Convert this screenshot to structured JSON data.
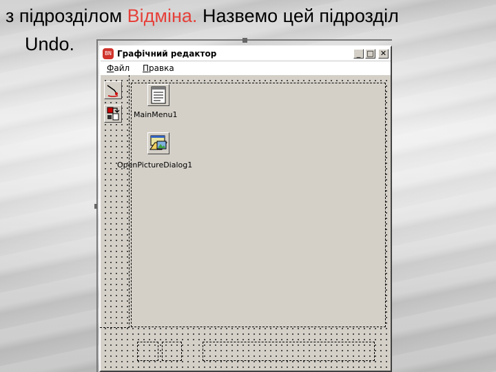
{
  "slide": {
    "line1_start": "з підрозділом ",
    "line1_highlight": "Відміна.",
    "line1_end": " Назвемо цей підрозділ",
    "line2": "Undo."
  },
  "window": {
    "title": "Графічний редактор",
    "icon_text": "BN",
    "buttons": {
      "minimize": "_",
      "maximize": "□",
      "close": "✕"
    }
  },
  "menu": {
    "items": [
      {
        "label_u": "Ф",
        "label_rest": "айл"
      },
      {
        "label_u": "П",
        "label_rest": "равка"
      }
    ]
  },
  "components": {
    "main_menu": {
      "label": "MainMenu1",
      "icon": "main-menu-component-icon"
    },
    "open_picture_dialog": {
      "label": "OpenPictureDialog1",
      "icon": "open-picture-dialog-icon"
    }
  },
  "toolbar": {
    "tools": [
      {
        "icon": "pen-tool-icon"
      },
      {
        "icon": "fill-tool-icon"
      }
    ]
  },
  "colors": {
    "highlight": "#e5403a",
    "form_bg": "#d4d0c8",
    "app_icon": "#d0342c"
  }
}
